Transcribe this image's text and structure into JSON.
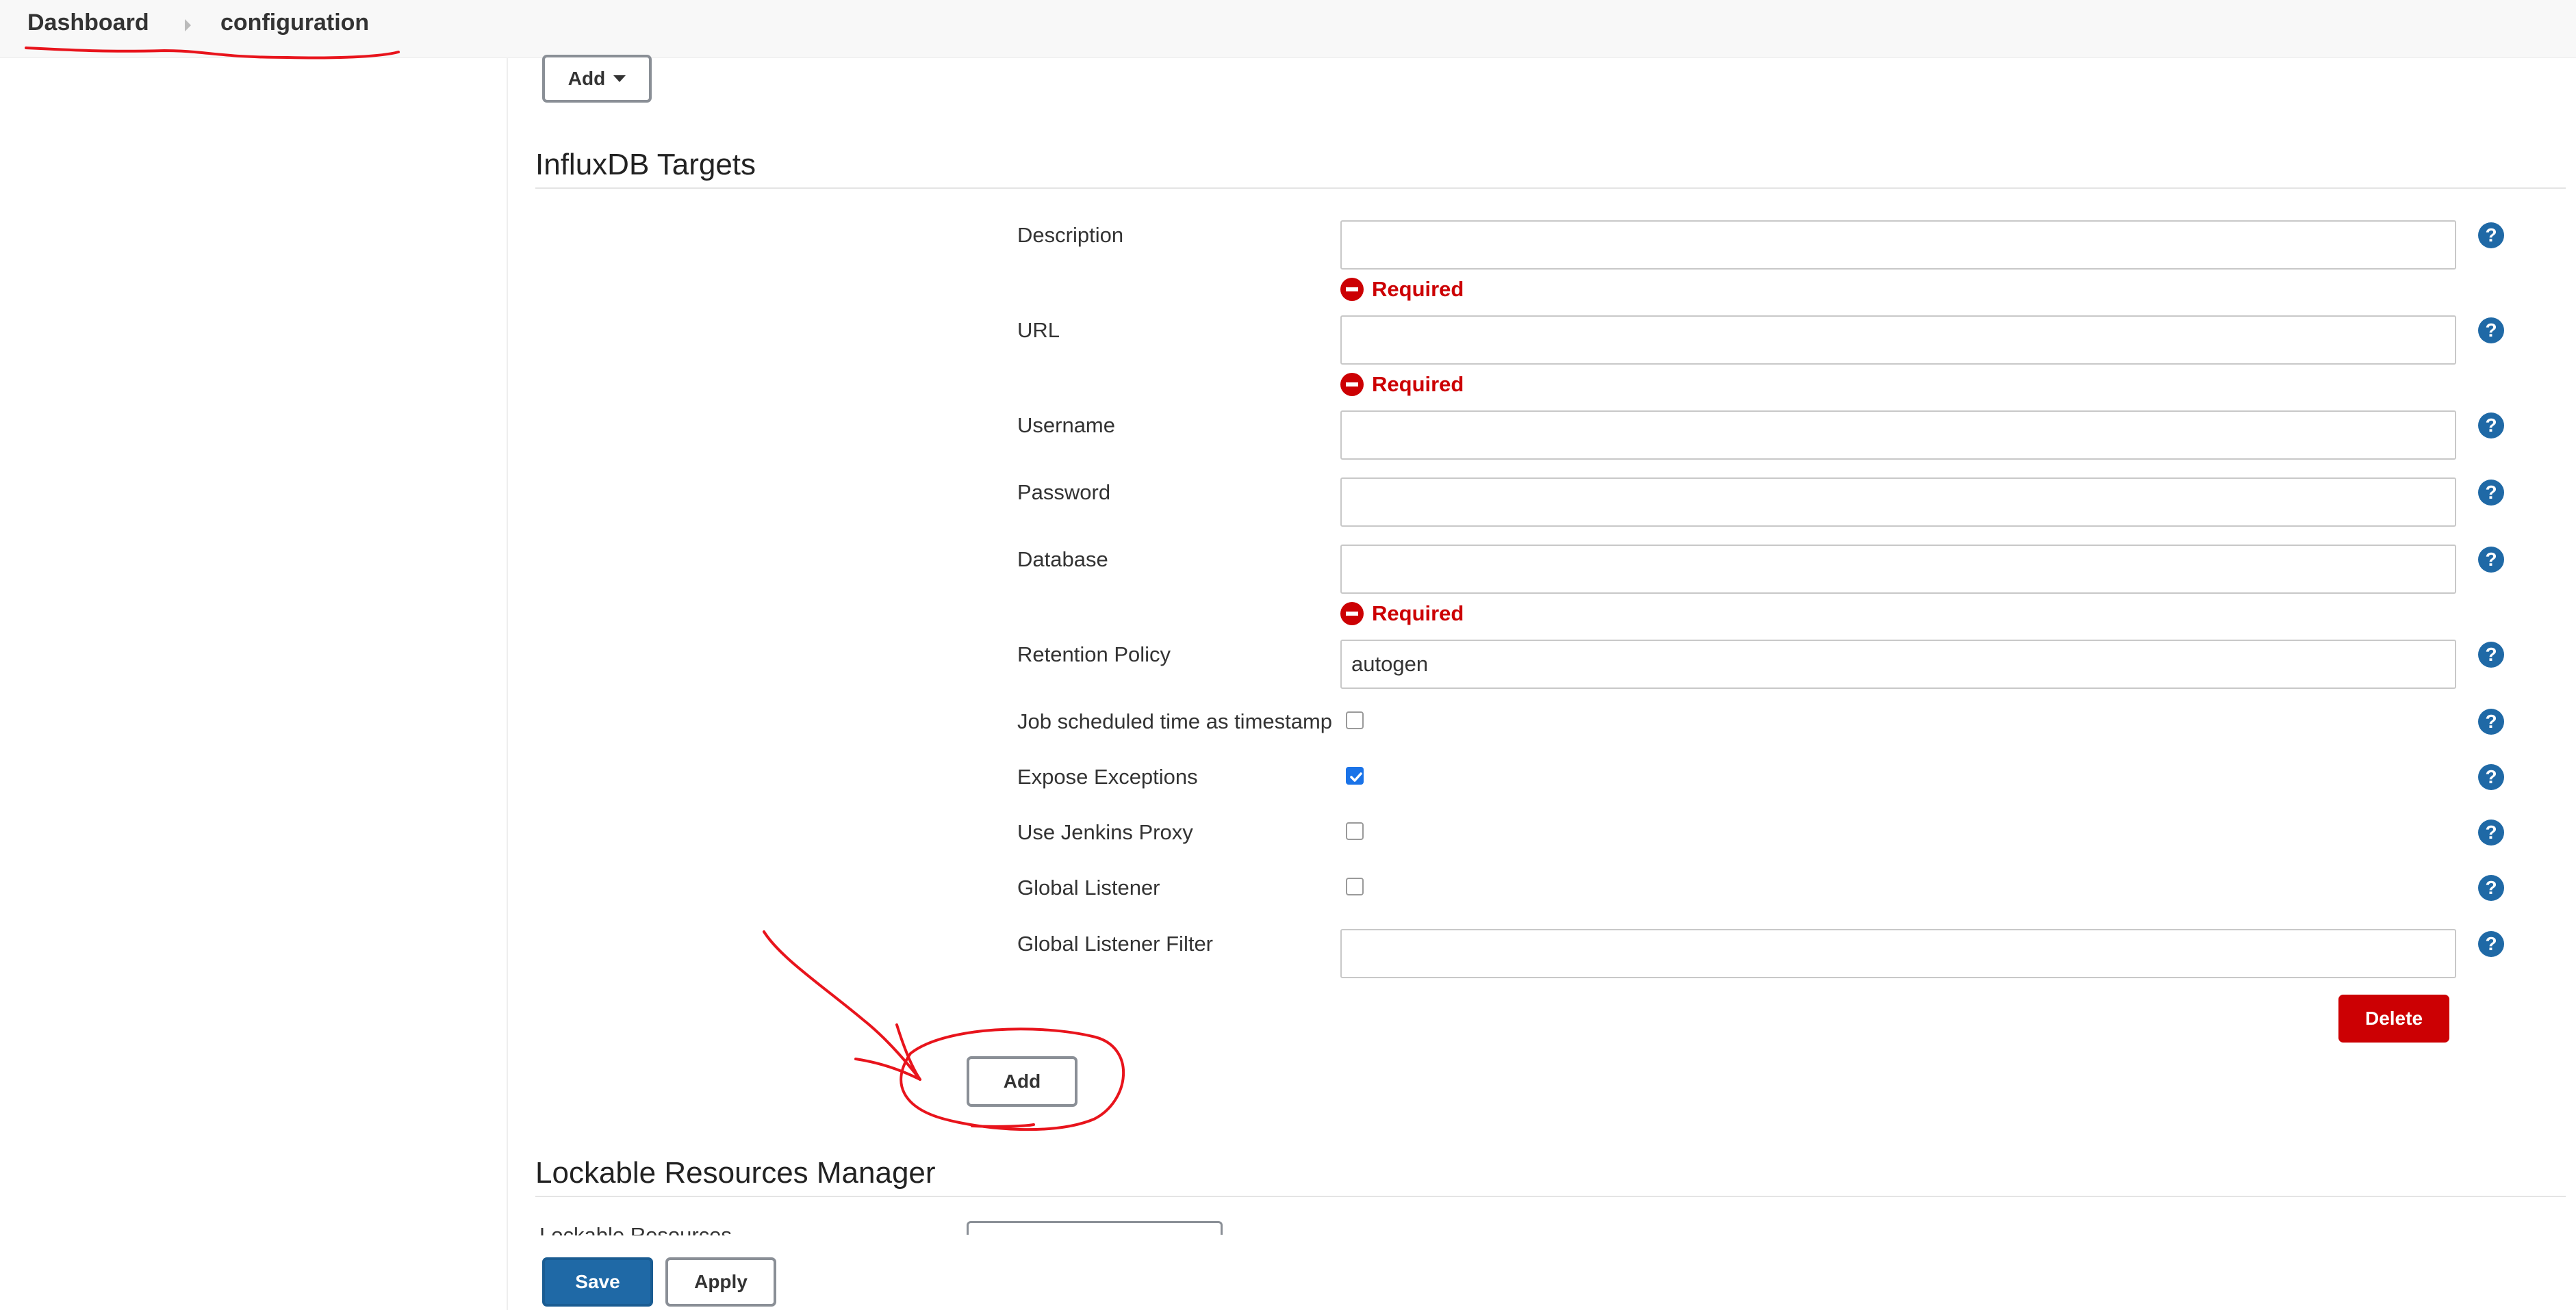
{
  "breadcrumb": {
    "items": [
      "Dashboard",
      "configuration"
    ]
  },
  "top_add_button": "Add",
  "influx": {
    "title": "InfluxDB Targets",
    "fields": {
      "description": {
        "label": "Description",
        "value": "",
        "error": "Required"
      },
      "url": {
        "label": "URL",
        "value": "",
        "error": "Required"
      },
      "username": {
        "label": "Username",
        "value": ""
      },
      "password": {
        "label": "Password",
        "value": ""
      },
      "database": {
        "label": "Database",
        "value": "",
        "error": "Required"
      },
      "retention_policy": {
        "label": "Retention Policy",
        "value": "autogen"
      },
      "job_scheduled_time": {
        "label": "Job scheduled time as timestamp",
        "checked": false
      },
      "expose_exceptions": {
        "label": "Expose Exceptions",
        "checked": true
      },
      "use_jenkins_proxy": {
        "label": "Use Jenkins Proxy",
        "checked": false
      },
      "global_listener": {
        "label": "Global Listener",
        "checked": false
      },
      "global_listener_filter": {
        "label": "Global Listener Filter",
        "value": ""
      }
    },
    "help_glyph": "?",
    "delete_label": "Delete",
    "add_label": "Add"
  },
  "lockable": {
    "title": "Lockable Resources Manager",
    "row_label": "Lockable Resources"
  },
  "footer": {
    "save_label": "Save",
    "apply_label": "Apply"
  },
  "colors": {
    "primary": "#1f69a6",
    "danger": "#cc0003",
    "checkbox_checked": "#1a73e8",
    "annotation": "#e8141c"
  },
  "icons": {
    "help": "help-icon",
    "error": "error-icon",
    "caret": "caret-down-icon",
    "breadcrumb_separator": "chevron-right-icon"
  }
}
